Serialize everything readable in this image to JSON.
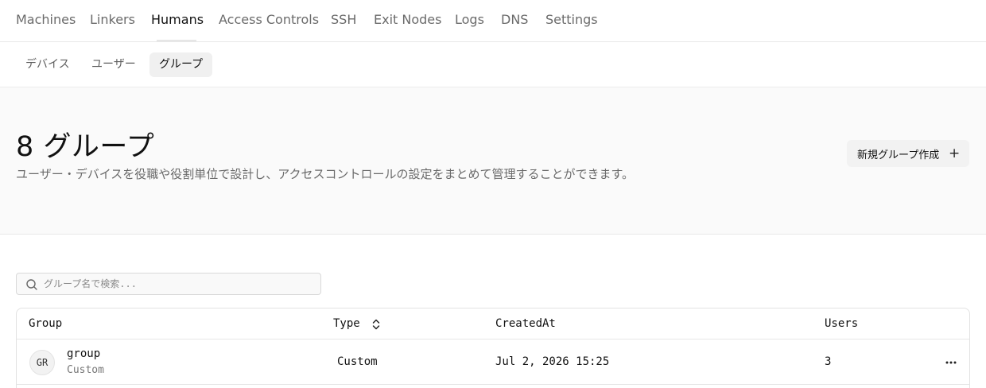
{
  "nav": {
    "items": [
      {
        "label": "Machines",
        "active": false
      },
      {
        "label": "Linkers",
        "active": false
      },
      {
        "label": "Humans",
        "active": true
      },
      {
        "label": "Access Controls",
        "active": false
      },
      {
        "label": "SSH",
        "active": false
      },
      {
        "label": "Exit Nodes",
        "active": false
      },
      {
        "label": "Logs",
        "active": false
      },
      {
        "label": "DNS",
        "active": false
      },
      {
        "label": "Settings",
        "active": false
      }
    ]
  },
  "subnav": {
    "tabs": [
      {
        "label": "デバイス",
        "active": false
      },
      {
        "label": "ユーザー",
        "active": false
      },
      {
        "label": "グループ",
        "active": true
      }
    ]
  },
  "header": {
    "title": "8 グループ",
    "description": "ユーザー・デバイスを役職や役割単位で設計し、アクセスコントロールの設定をまとめて管理することができます。",
    "new_group_label": "新規グループ作成",
    "new_group_icon": "plus-icon"
  },
  "search": {
    "placeholder": "グループ名で検索...",
    "value": "",
    "icon": "search-icon"
  },
  "table": {
    "columns": [
      "Group",
      "Type",
      "CreatedAt",
      "Users"
    ],
    "rows": [
      {
        "avatar": "GR",
        "name": "group",
        "subtitle": "Custom",
        "type": "Custom",
        "created_at": "Jul 2, 2026 15:25",
        "users": "3"
      }
    ]
  },
  "colors": {
    "text_primary": "#111111",
    "text_secondary": "#6b6b6b",
    "header_bg": "#fafafa",
    "border": "#e6e6e6"
  }
}
